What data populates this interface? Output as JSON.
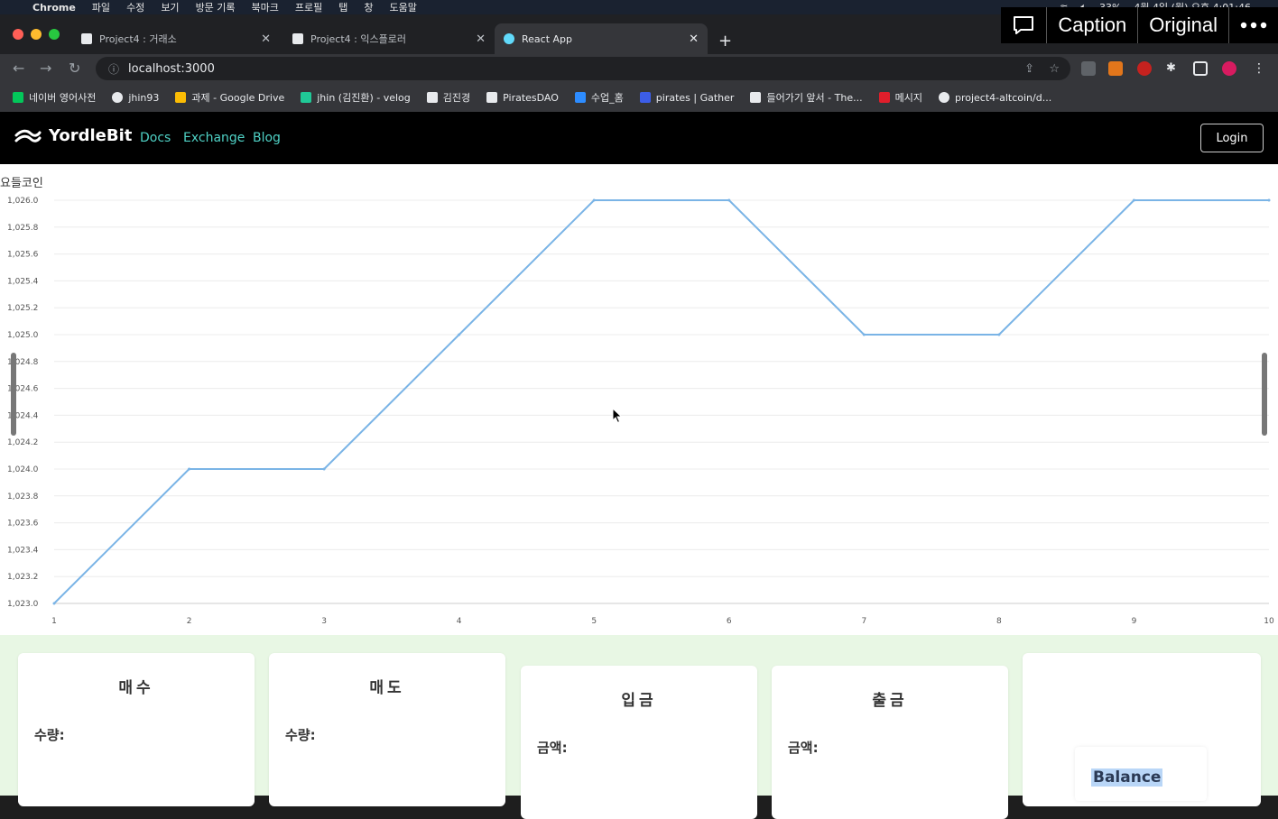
{
  "mac_menubar": {
    "app": "Chrome",
    "items": [
      "파일",
      "수정",
      "보기",
      "방문 기록",
      "북마크",
      "프로필",
      "탭",
      "창",
      "도움말"
    ],
    "battery": "33%",
    "datetime": "4월 4일 (월) 오후 4:01:46"
  },
  "overlay": {
    "caption": "Caption",
    "original": "Original"
  },
  "tabs": [
    {
      "label": "Project4 : 거래소",
      "active": false
    },
    {
      "label": "Project4 : 익스플로러",
      "active": false
    },
    {
      "label": "React App",
      "active": true
    }
  ],
  "address_bar": {
    "url": "localhost:3000"
  },
  "bookmarks": [
    "네이버 영어사전",
    "jhin93",
    "과제 - Google Drive",
    "jhin (김진환) - velog",
    "김진경",
    "PiratesDAO",
    "수업_홈",
    "pirates | Gather",
    "들어가기 앞서 - The...",
    "메시지",
    "project4-altcoin/d..."
  ],
  "navbar": {
    "brand": "YordleBit",
    "links": [
      "Docs",
      "Exchange",
      "Blog"
    ],
    "login": "Login"
  },
  "chart_data": {
    "type": "line",
    "title": "요들코인",
    "x": [
      1,
      2,
      3,
      4,
      5,
      6,
      7,
      8,
      9,
      10
    ],
    "values": [
      1023.0,
      1024.0,
      1024.0,
      1025.0,
      1026.0,
      1026.0,
      1025.0,
      1025.0,
      1026.0,
      1026.0
    ],
    "y_ticks": [
      "1,023.0",
      "1,023.2",
      "1,023.4",
      "1,023.6",
      "1,023.8",
      "1,024.0",
      "1,024.2",
      "1,024.4",
      "1,024.6",
      "1,024.8",
      "1,025.0",
      "1,025.2",
      "1,025.4",
      "1,025.6",
      "1,025.8",
      "1,026.0"
    ],
    "x_ticks": [
      "1",
      "2",
      "3",
      "4",
      "5",
      "6",
      "7",
      "8",
      "9",
      "10"
    ],
    "ylim": [
      1023.0,
      1026.0
    ],
    "line_color": "#7ab4e6",
    "grid": true
  },
  "cards": {
    "buy": {
      "title": "매수",
      "label": "수량:"
    },
    "sell": {
      "title": "매도",
      "label": "수량:"
    },
    "deposit": {
      "title": "입금",
      "label": "금액:"
    },
    "withdraw": {
      "title": "출금",
      "label": "금액:"
    },
    "balance": {
      "label": "Balance"
    }
  }
}
